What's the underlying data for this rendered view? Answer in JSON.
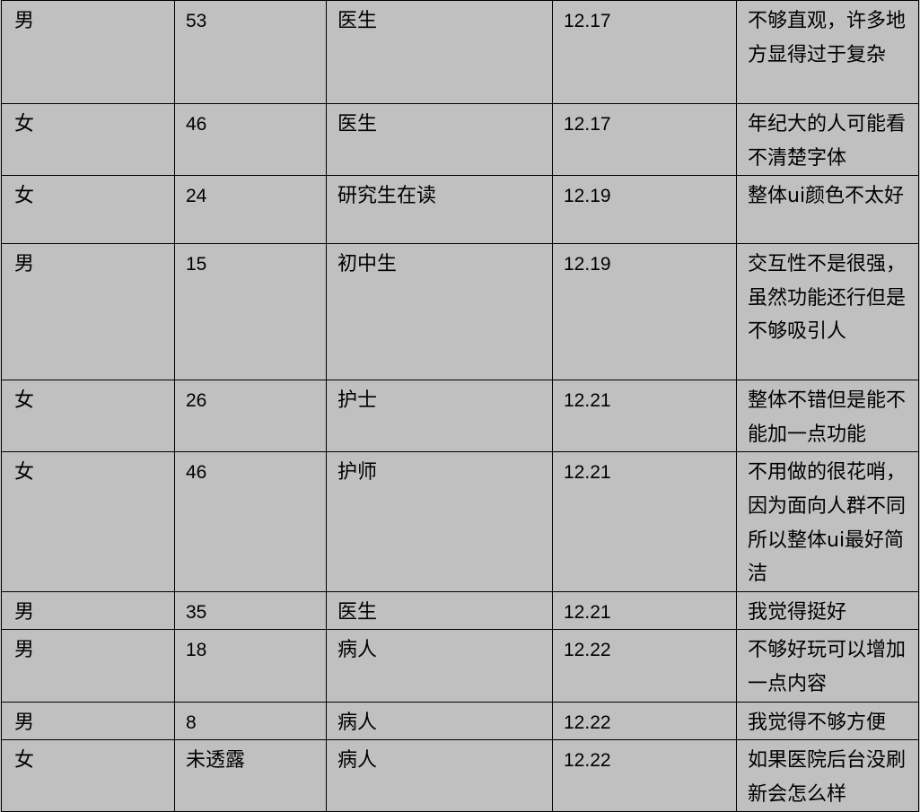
{
  "table": {
    "rows": [
      {
        "gender": "男",
        "age": "53",
        "occupation": "医生",
        "date": "12.17",
        "comment": "不够直观，许多地方显得过于复杂"
      },
      {
        "gender": "女",
        "age": "46",
        "occupation": "医生",
        "date": "12.17",
        "comment": "年纪大的人可能看不清楚字体"
      },
      {
        "gender": "女",
        "age": "24",
        "occupation": "研究生在读",
        "date": "12.19",
        "comment": "整体ui颜色不太好"
      },
      {
        "gender": "男",
        "age": "15",
        "occupation": "初中生",
        "date": "12.19",
        "comment": "交互性不是很强，虽然功能还行但是不够吸引人"
      },
      {
        "gender": "女",
        "age": "26",
        "occupation": "护士",
        "date": "12.21",
        "comment": "整体不错但是能不能加一点功能"
      },
      {
        "gender": "女",
        "age": "46",
        "occupation": "护师",
        "date": "12.21",
        "comment": "不用做的很花哨，因为面向人群不同所以整体ui最好简洁"
      },
      {
        "gender": "男",
        "age": "35",
        "occupation": "医生",
        "date": "12.21",
        "comment": "我觉得挺好"
      },
      {
        "gender": "男",
        "age": "18",
        "occupation": "病人",
        "date": "12.22",
        "comment": "不够好玩可以增加一点内容"
      },
      {
        "gender": "男",
        "age": "8",
        "occupation": "病人",
        "date": "12.22",
        "comment": "我觉得不够方便"
      },
      {
        "gender": "女",
        "age": "未透露",
        "occupation": "病人",
        "date": "12.22",
        "comment": "如果医院后台没刷新会怎么样"
      }
    ]
  }
}
